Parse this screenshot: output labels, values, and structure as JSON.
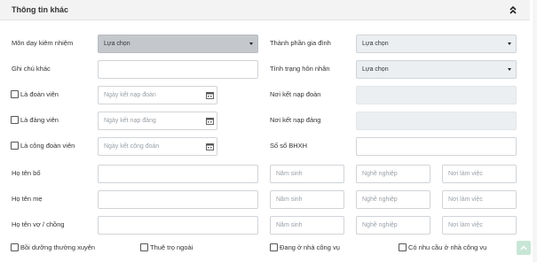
{
  "section": {
    "title": "Thông tin khác"
  },
  "fields": {
    "mon_day": {
      "label": "Môn dạy kiêm nhiệm",
      "value": "Lựa chọn"
    },
    "thanh_phan": {
      "label": "Thành phần gia đình",
      "value": "Lựa chọn"
    },
    "ghi_chu": {
      "label": "Ghi chú khác",
      "value": ""
    },
    "tinh_trang": {
      "label": "Tình trạng hôn nhân",
      "value": "Lựa chọn"
    },
    "doan_vien": {
      "label": "Là đoàn viên",
      "placeholder": "Ngày kết nạp đoàn"
    },
    "noi_doan": {
      "label": "Nơi kết nạp đoàn"
    },
    "dang_vien": {
      "label": "Là đảng viên",
      "placeholder": "Ngày kết nạp đảng"
    },
    "noi_dang": {
      "label": "Nơi kết nạp đảng"
    },
    "cong_doan": {
      "label": "Là công đoàn viên",
      "placeholder": "Ngày kết công đoàn"
    },
    "bhxh": {
      "label": "Số sổ BHXH"
    },
    "ho_ten_bo": {
      "label": "Họ tên bố"
    },
    "ho_ten_me": {
      "label": "Họ tên mẹ"
    },
    "ho_ten_vo": {
      "label": "Họ tên vợ / chồng"
    }
  },
  "placeholders": {
    "nam_sinh": "Năm sinh",
    "nghe_nghiep": "Nghề nghiệp",
    "noi_lam_viec": "Nơi làm việc"
  },
  "checkboxes": {
    "boi_duong": "Bồi dưỡng thường xuyên",
    "thue_tro": "Thuê trọ ngoài",
    "nha_cong_vu": "Đang ở nhà công vụ",
    "nhu_cau": "Có nhu cầu ở nhà công vụ"
  },
  "icons": {
    "collapse": "double-chevron-up-icon",
    "calendar": "calendar-icon",
    "dropdown": "caret-down-icon",
    "scroll_top": "arrow-up-icon"
  }
}
